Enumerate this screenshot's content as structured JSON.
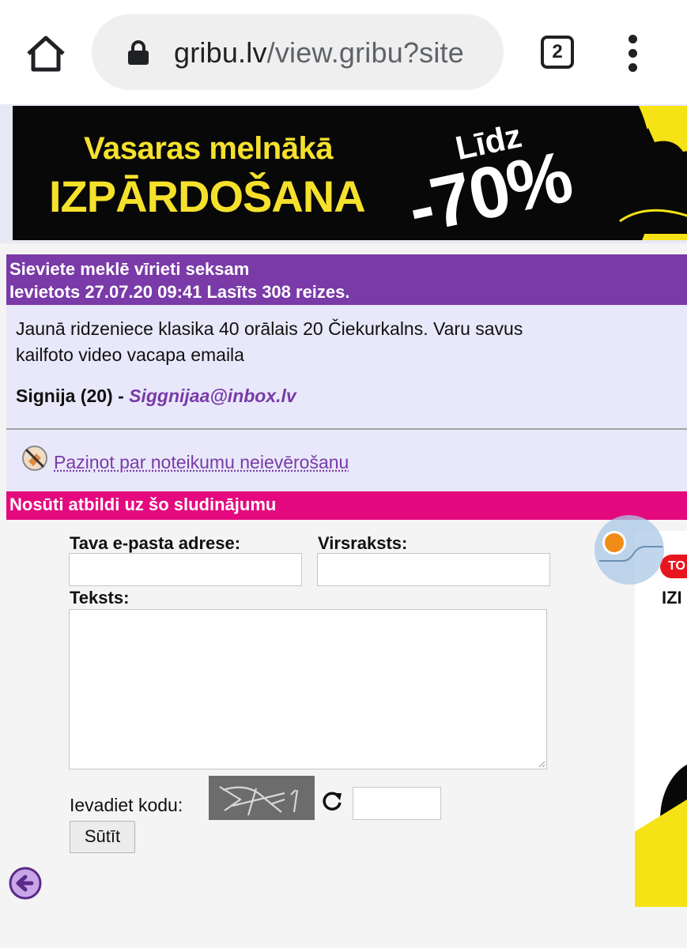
{
  "browser": {
    "url_host": "gribu.lv",
    "url_path": "/view.gribu?site",
    "tab_count": "2",
    "icons": [
      "home-icon",
      "lock-icon",
      "tabs-icon",
      "more-vert-icon"
    ]
  },
  "banner": {
    "line1": "Vasaras melnākā",
    "line2": "IZPĀRDOŠANA",
    "lidz": "Līdz",
    "percent": "-70%",
    "colors": {
      "background": "#080808",
      "accent": "#f5e12c"
    }
  },
  "ad": {
    "title": "Sieviete meklē vīrieti seksam",
    "meta": "Ievietots 27.07.20 09:41 Lasīts 308 reizes.",
    "text": "Jaunā ridzeniece klasika 40 orālais 20 Čiekurkalns. Varu savus kailfoto video vacapa emaila",
    "author": "Signija (20) - ",
    "email": "Siggnijaa@inbox.lv",
    "report_link": "Paziņot par noteikumu neievērošanu",
    "header_color": "#7a3aa8"
  },
  "reply": {
    "header": "Nosūti atbildi uz šo sludinājumu",
    "email_label": "Tava e-pasta adrese:",
    "email_value": "",
    "subject_label": "Virsraksts:",
    "subject_value": "",
    "text_label": "Teksts:",
    "text_value": "",
    "captcha_label": "Ievadiet kodu:",
    "captcha_value": "",
    "send_label": "Sūtīt",
    "header_color": "#e4097e"
  },
  "side_ad": {
    "badge": "TO",
    "text": "IZI"
  }
}
